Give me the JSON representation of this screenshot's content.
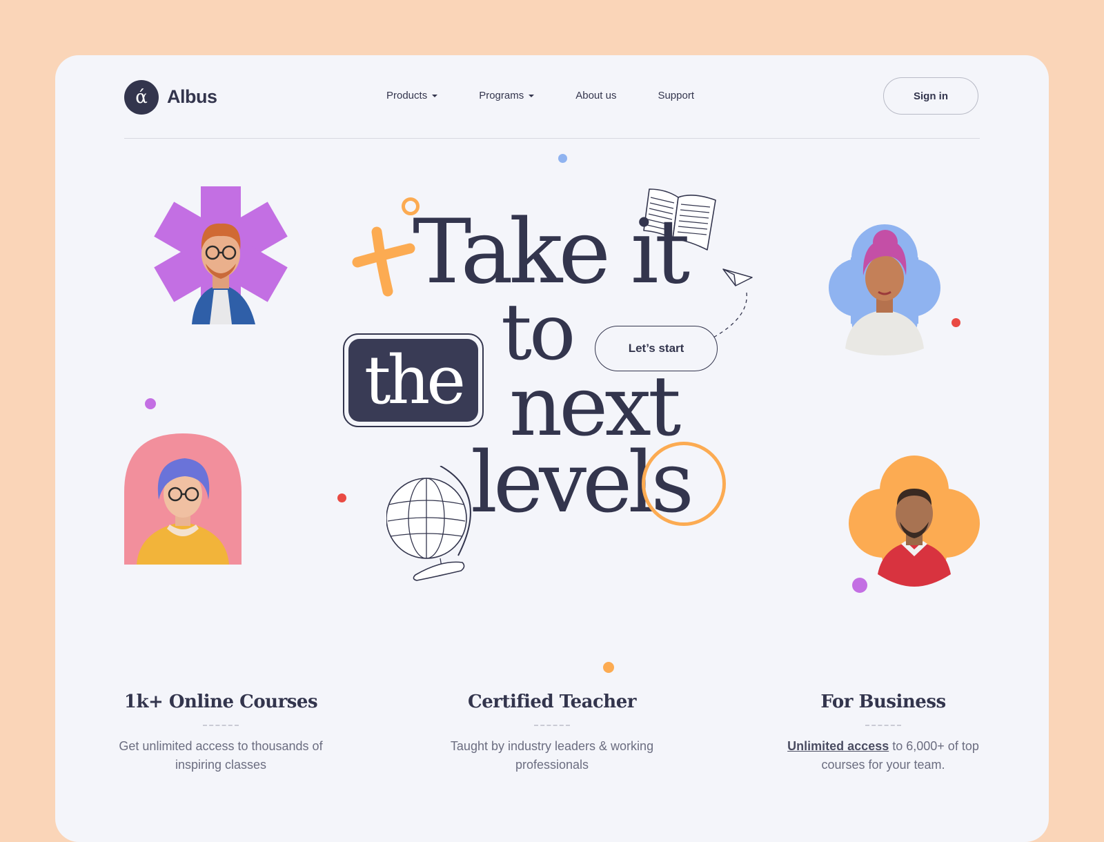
{
  "brand": {
    "logo_glyph": "ά",
    "name": "Albus"
  },
  "nav": {
    "items": [
      {
        "label": "Products",
        "has_dropdown": true
      },
      {
        "label": "Programs",
        "has_dropdown": true
      },
      {
        "label": "About us",
        "has_dropdown": false
      },
      {
        "label": "Support",
        "has_dropdown": false
      }
    ],
    "signin_label": "Sign in"
  },
  "hero": {
    "line1": "Take it",
    "word_boxed": "the",
    "line2": "to",
    "line3": "next",
    "line4": "levels",
    "cta_label": "Let’s start"
  },
  "features": [
    {
      "title": "1k+ Online Courses",
      "desc": "Get unlimited access to thousands of inspiring classes"
    },
    {
      "title": "Certified Teacher",
      "desc": "Taught by industry leaders & working professionals"
    },
    {
      "title": "For Business",
      "link": "Unlimited access",
      "desc_rest": " to 6,000+ of top courses for your team."
    }
  ],
  "colors": {
    "page_bg": "#fad5b8",
    "card_bg": "#f4f5fa",
    "ink": "#33354d",
    "purple": "#c36fe3",
    "blue": "#8fb3f0",
    "pink": "#f28f9c",
    "orange": "#fcab52",
    "red": "#e94a43"
  },
  "icons": [
    "open-book-icon",
    "paper-plane-icon",
    "globe-icon",
    "plus-cross-icon"
  ]
}
